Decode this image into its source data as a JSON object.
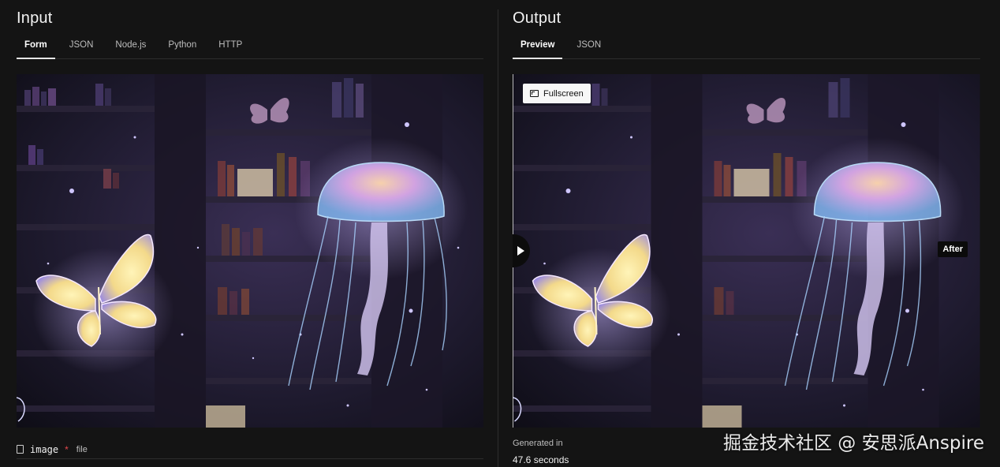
{
  "input": {
    "title": "Input",
    "tabs": [
      "Form",
      "JSON",
      "Node.js",
      "Python",
      "HTTP"
    ],
    "active_tab": "Form",
    "field": {
      "name": "image",
      "required_mark": "*",
      "type": "file"
    }
  },
  "output": {
    "title": "Output",
    "tabs": [
      "Preview",
      "JSON"
    ],
    "active_tab": "Preview",
    "fullscreen_label": "Fullscreen",
    "after_label": "After",
    "generated_label": "Generated in",
    "generated_value": "47.6 seconds"
  },
  "watermark": "掘金技术社区 @ 安思派Anspire",
  "colors": {
    "background": "#141414",
    "divider": "#2e2e2e",
    "required": "#e5484d"
  },
  "icons": [
    "file-icon",
    "fullscreen-icon",
    "play-icon"
  ]
}
